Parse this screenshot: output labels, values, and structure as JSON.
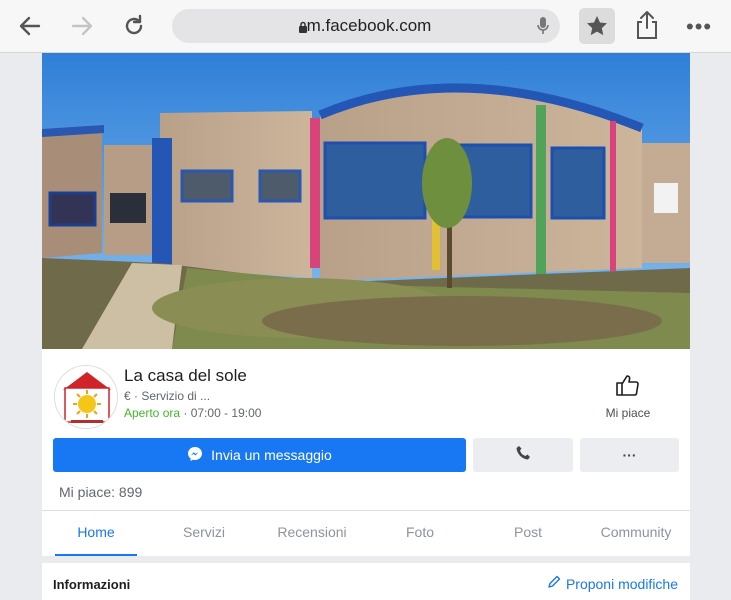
{
  "browser": {
    "url": "m.facebook.com",
    "icons": [
      "back-arrow-icon",
      "forward-arrow-icon",
      "reload-icon",
      "lock-icon",
      "microphone-icon",
      "star-icon",
      "share-icon",
      "more-icon"
    ],
    "more_glyph": "•••"
  },
  "page": {
    "name": "La casa del sole",
    "category": "€ · Servizio di ...",
    "open_status": "Aperto ora",
    "hours": " · 07:00 - 19:00",
    "like_label": "Mi piace",
    "message_button": "Invia un messaggio",
    "more_button": "···",
    "likes_count": "Mi piace: 899",
    "accent_color": "#1877f2",
    "open_color": "#42b72a"
  },
  "tabs": [
    {
      "label": "Home",
      "active": true
    },
    {
      "label": "Servizi"
    },
    {
      "label": "Recensioni"
    },
    {
      "label": "Foto"
    },
    {
      "label": "Post"
    },
    {
      "label": "Community"
    }
  ],
  "info": {
    "title": "Informazioni",
    "suggest_edits": "Proponi modifiche"
  }
}
